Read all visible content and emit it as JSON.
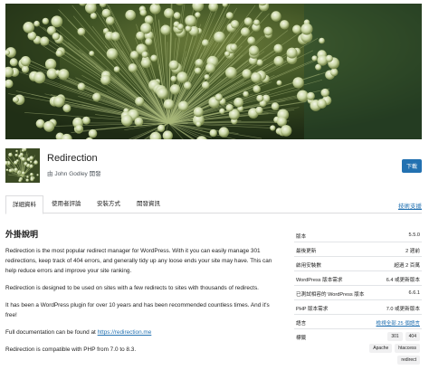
{
  "plugin": {
    "name": "Redirection",
    "author_prefix": "由",
    "author_name": "John Godley",
    "author_suffix": "開發",
    "download_label": "下載"
  },
  "tabs": [
    {
      "label": "詳細資料",
      "active": true
    },
    {
      "label": "使用者評論",
      "active": false
    },
    {
      "label": "安裝方式",
      "active": false
    },
    {
      "label": "開發資訊",
      "active": false
    }
  ],
  "support_link": "技術支援",
  "description": {
    "title": "外掛說明",
    "p1": "Redirection is the most popular redirect manager for WordPress. With it you can easily manage 301 redirections, keep track of 404 errors, and generally tidy up any loose ends your site may have. This can help reduce errors and improve your site ranking.",
    "p2": "Redirection is designed to be used on sites with a few redirects to sites with thousands of redirects.",
    "p3": "It has been a WordPress plugin for over 10 years and has been recommended countless times. And it's free!",
    "p4_prefix": "Full documentation can be found at",
    "p4_link": "https://redirection.me",
    "p5": "Redirection is compatible with PHP from 7.0 to 8.3."
  },
  "meta": {
    "version_label": "版本",
    "version_value": "5.5.0",
    "updated_label": "最後更新",
    "updated_value": "2 週前",
    "installs_label": "啟用安裝數",
    "installs_value": "超過 2 百萬",
    "wp_req_label": "WordPress 版本需求",
    "wp_req_value": "6.4 或更新版本",
    "tested_label": "已測試相容的 WordPress 版本",
    "tested_value": "6.6.1",
    "php_label": "PHP 版本需求",
    "php_value": "7.0 或更新版本",
    "lang_label": "語言",
    "lang_value": "檢視全部 25 個語言",
    "tags_label": "標籤",
    "tags": [
      "301",
      "404",
      "Apache",
      "htaccess",
      "redirect"
    ]
  },
  "colors": {
    "accent": "#2271b1"
  }
}
